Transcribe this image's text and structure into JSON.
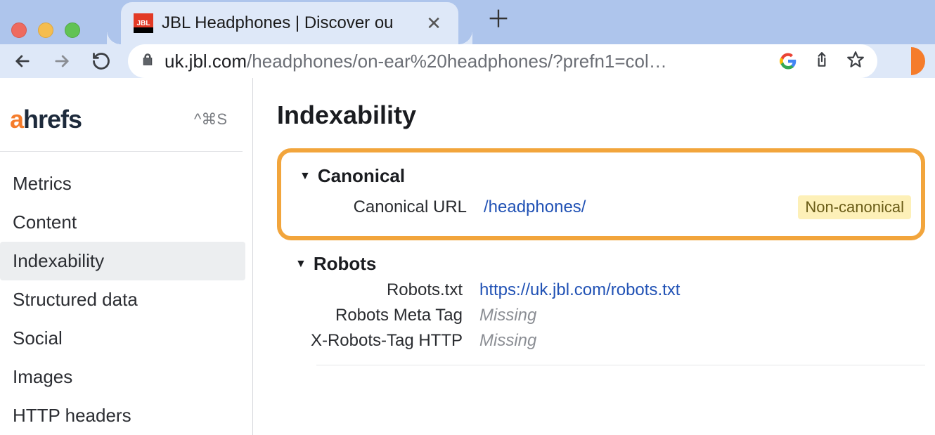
{
  "browser": {
    "tab_title": "JBL Headphones | Discover ou",
    "url_host": "uk.jbl.com",
    "url_path": "/headphones/on-ear%20headphones/?prefn1=col…",
    "google_letter": "G"
  },
  "sidebar": {
    "brand_prefix": "a",
    "brand_rest": "hrefs",
    "shortcut": "^⌘S",
    "items": [
      "Metrics",
      "Content",
      "Indexability",
      "Structured data",
      "Social",
      "Images",
      "HTTP headers"
    ],
    "active_index": 2
  },
  "main": {
    "title": "Indexability",
    "canonical": {
      "heading": "Canonical",
      "label": "Canonical URL",
      "value": "/headphones/",
      "badge": "Non-canonical"
    },
    "robots": {
      "heading": "Robots",
      "rows": [
        {
          "label": "Robots.txt",
          "value": "https://uk.jbl.com/robots.txt",
          "kind": "link"
        },
        {
          "label": "Robots Meta Tag",
          "value": "Missing",
          "kind": "missing"
        },
        {
          "label": "X-Robots-Tag HTTP",
          "value": "Missing",
          "kind": "missing"
        }
      ]
    }
  }
}
